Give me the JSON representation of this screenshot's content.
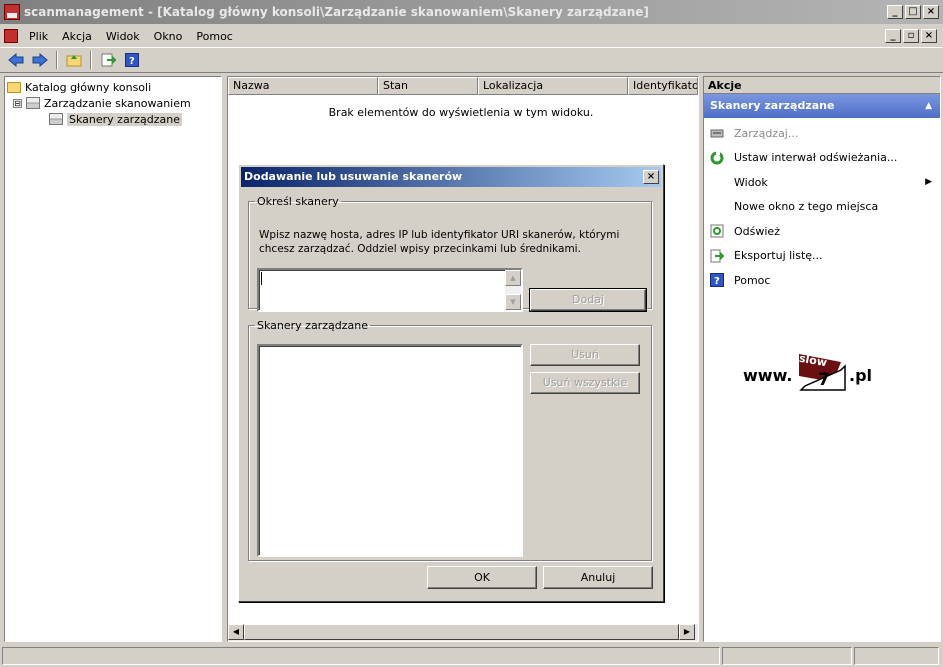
{
  "window": {
    "title": "scanmanagement - [Katalog główny konsoli\\Zarządzanie skanowaniem\\Skanery zarządzane]",
    "controls": [
      "_",
      "□",
      "×"
    ]
  },
  "menubar": {
    "items": [
      "Plik",
      "Akcja",
      "Widok",
      "Okno",
      "Pomoc"
    ]
  },
  "toolbar": {
    "icons": [
      "back-arrow-icon",
      "forward-arrow-icon",
      "up-folder-icon",
      "export-icon",
      "help-icon"
    ]
  },
  "tree": {
    "root": "Katalog główny konsoli",
    "child": "Zarządzanie skanowaniem",
    "grandchild": "Skanery zarządzane",
    "expander": "⊟"
  },
  "list": {
    "columns": [
      "Nazwa",
      "Stan",
      "Lokalizacja",
      "Identyfikator"
    ],
    "empty_message": "Brak elementów do wyświetlenia w tym widoku."
  },
  "actions": {
    "header": "Akcje",
    "section": "Skanery zarządzane",
    "items": [
      {
        "label": "Zarządzaj...",
        "icon": "manage-icon",
        "disabled": true
      },
      {
        "label": "Ustaw interwał odświeżania...",
        "icon": "refresh-interval-icon",
        "disabled": false
      },
      {
        "label": "Widok",
        "icon": "",
        "disabled": false
      },
      {
        "label": "Nowe okno z tego miejsca",
        "icon": "",
        "disabled": false
      },
      {
        "label": "Odśwież",
        "icon": "refresh-icon",
        "disabled": false
      },
      {
        "label": "Eksportuj listę...",
        "icon": "export-list-icon",
        "disabled": false
      },
      {
        "label": "Pomoc",
        "icon": "help-icon",
        "disabled": false
      }
    ]
  },
  "dialog": {
    "title": "Dodawanie lub usuwanie skanerów",
    "close": "×",
    "group1": {
      "legend": "Określ skanery",
      "description": "Wpisz nazwę hosta, adres IP lub identyfikator URI skanerów, którymi chcesz zarządzać. Oddziel wpisy przecinkami lub średnikami.",
      "input_value": "",
      "add_button": "Dodaj"
    },
    "group2": {
      "legend": "Skanery zarządzane",
      "remove_button": "Usuń",
      "remove_all_button": "Usuń wszystkie"
    },
    "ok_button": "OK",
    "cancel_button": "Anuluj"
  },
  "watermark": {
    "prefix": "www.",
    "flag_text": "slow",
    "number": "7",
    "suffix": ".pl"
  },
  "colors": {
    "accent": "#4e6fc9",
    "dialog_title": "#0a246a",
    "face": "#d4d0c8"
  }
}
